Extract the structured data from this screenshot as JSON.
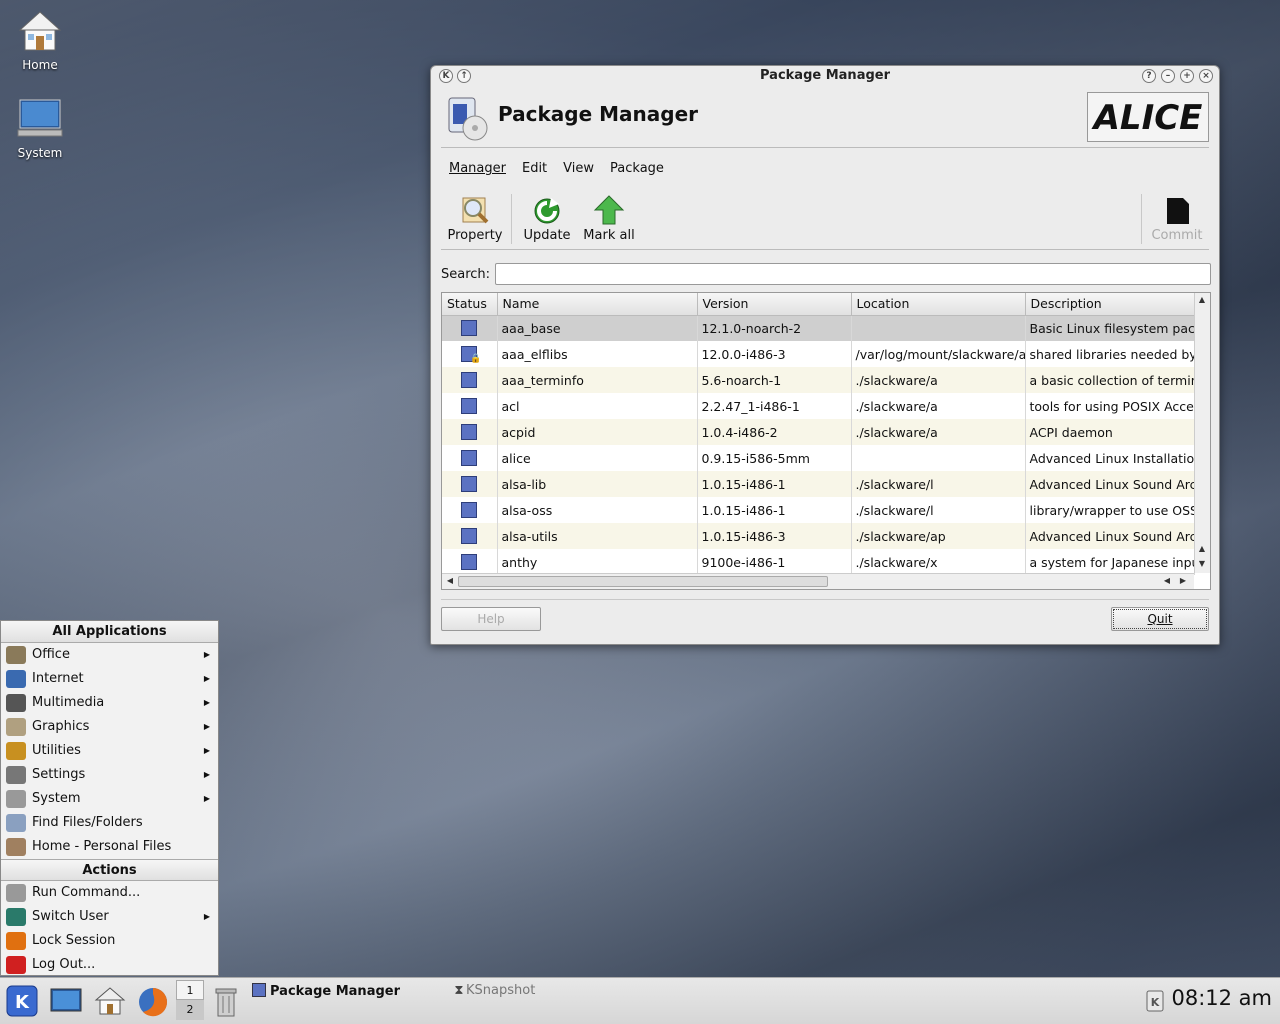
{
  "desktop": {
    "icons": [
      {
        "label": "Home"
      },
      {
        "label": "System"
      }
    ]
  },
  "window": {
    "title": "Package Manager",
    "header_title": "Package Manager",
    "brand": "ALICE",
    "menu": [
      "Manager",
      "Edit",
      "View",
      "Package"
    ],
    "toolbar": {
      "property": "Property",
      "update": "Update",
      "mark_all": "Mark all",
      "commit": "Commit"
    },
    "search_label": "Search:",
    "search_value": "",
    "columns": [
      "Status",
      "Name",
      "Version",
      "Location",
      "Description"
    ],
    "rows": [
      {
        "name": "aaa_base",
        "version": "12.1.0-noarch-2",
        "location": "",
        "description": "Basic Linux filesystem pack",
        "locked": false
      },
      {
        "name": "aaa_elflibs",
        "version": "12.0.0-i486-3",
        "location": "/var/log/mount/slackware/a/",
        "description": "shared libraries needed by",
        "locked": true
      },
      {
        "name": "aaa_terminfo",
        "version": "5.6-noarch-1",
        "location": "./slackware/a",
        "description": "a basic collection of termin",
        "locked": false
      },
      {
        "name": "acl",
        "version": "2.2.47_1-i486-1",
        "location": "./slackware/a",
        "description": "tools for using POSIX Acces",
        "locked": false
      },
      {
        "name": "acpid",
        "version": "1.0.4-i486-2",
        "location": "./slackware/a",
        "description": "ACPI daemon",
        "locked": false
      },
      {
        "name": "alice",
        "version": "0.9.15-i586-5mm",
        "location": "",
        "description": "Advanced Linux Installation",
        "locked": false
      },
      {
        "name": "alsa-lib",
        "version": "1.0.15-i486-1",
        "location": "./slackware/l",
        "description": "Advanced Linux Sound Arc",
        "locked": false
      },
      {
        "name": "alsa-oss",
        "version": "1.0.15-i486-1",
        "location": "./slackware/l",
        "description": "library/wrapper to use OSS",
        "locked": false
      },
      {
        "name": "alsa-utils",
        "version": "1.0.15-i486-3",
        "location": "./slackware/ap",
        "description": "Advanced Linux Sound Arc",
        "locked": false
      },
      {
        "name": "anthy",
        "version": "9100e-i486-1",
        "location": "./slackware/x",
        "description": "a system for Japanese inpu",
        "locked": false
      }
    ],
    "help_button": "Help",
    "quit_button": "Quit"
  },
  "start_menu": {
    "apps_header": "All Applications",
    "apps": [
      {
        "label": "Office",
        "submenu": true,
        "color": "#8a7a5a"
      },
      {
        "label": "Internet",
        "submenu": true,
        "color": "#3a6ab0"
      },
      {
        "label": "Multimedia",
        "submenu": true,
        "color": "#555555"
      },
      {
        "label": "Graphics",
        "submenu": true,
        "color": "#b0a080"
      },
      {
        "label": "Utilities",
        "submenu": true,
        "color": "#c89020"
      },
      {
        "label": "Settings",
        "submenu": true,
        "color": "#777777"
      },
      {
        "label": "System",
        "submenu": true,
        "color": "#999999"
      },
      {
        "label": "Find Files/Folders",
        "submenu": false,
        "color": "#8aa0c0"
      },
      {
        "label": "Home - Personal Files",
        "submenu": false,
        "color": "#a08060"
      }
    ],
    "actions_header": "Actions",
    "actions": [
      {
        "label": "Run Command...",
        "submenu": false,
        "color": "#999999"
      },
      {
        "label": "Switch User",
        "submenu": true,
        "color": "#2a7a6a"
      },
      {
        "label": "Lock Session",
        "submenu": false,
        "color": "#e07010"
      },
      {
        "label": "Log Out...",
        "submenu": false,
        "color": "#d02020"
      }
    ]
  },
  "taskbar": {
    "pager": [
      "1",
      "2"
    ],
    "tasks": [
      "Package Manager",
      "KSnapshot"
    ],
    "clock": "08:12 am"
  }
}
